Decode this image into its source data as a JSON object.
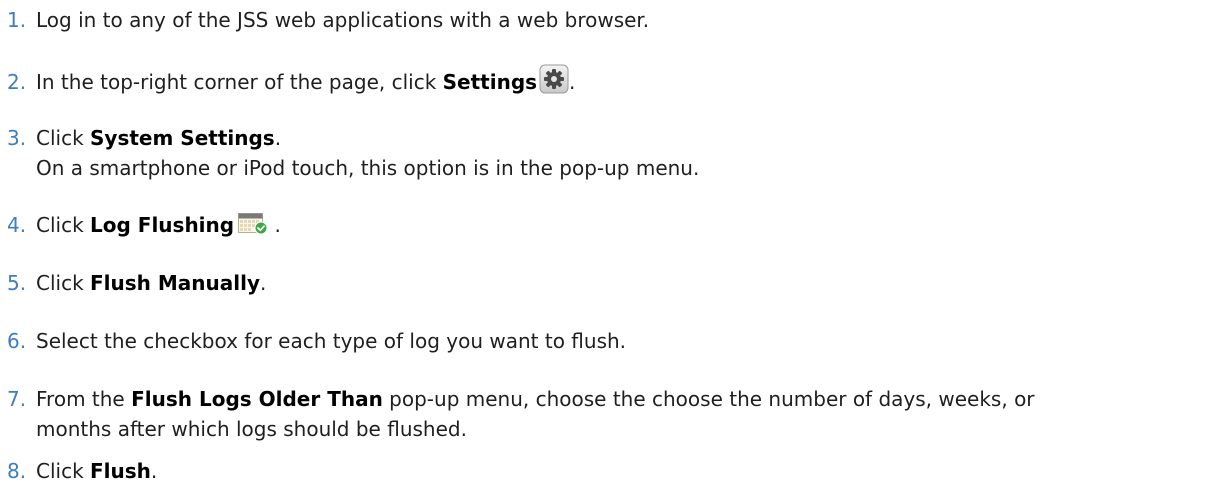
{
  "colors": {
    "step_number": "#3e7dc0",
    "text": "#1f1f1f",
    "emphasis": "#000000"
  },
  "steps": [
    {
      "number": "1.",
      "text": "Log in to any of the JSS web applications with a web browser."
    },
    {
      "number": "2.",
      "before": "In the top-right corner of the page, click ",
      "bold": "Settings",
      "icon": "gear-icon",
      "after": "."
    },
    {
      "number": "3.",
      "before": "Click ",
      "bold": "System Settings",
      "after": ".",
      "continuation": "On a smartphone or iPod touch, this option is in the pop-up menu."
    },
    {
      "number": "4.",
      "before": "Click ",
      "bold": "Log Flushing",
      "icon": "calendar-check-icon",
      "after": "."
    },
    {
      "number": "5.",
      "before": "Click ",
      "bold": "Flush Manually",
      "after": "."
    },
    {
      "number": "6.",
      "text": "Select the checkbox for each type of log you want to flush."
    },
    {
      "number": "7.",
      "before": "From the ",
      "bold": "Flush Logs Older Than",
      "after": " pop-up menu, choose the choose the number of days, weeks, or",
      "continuation": "months after which logs should be flushed."
    },
    {
      "number": "8.",
      "before": "Click ",
      "bold": "Flush",
      "after": "."
    }
  ]
}
